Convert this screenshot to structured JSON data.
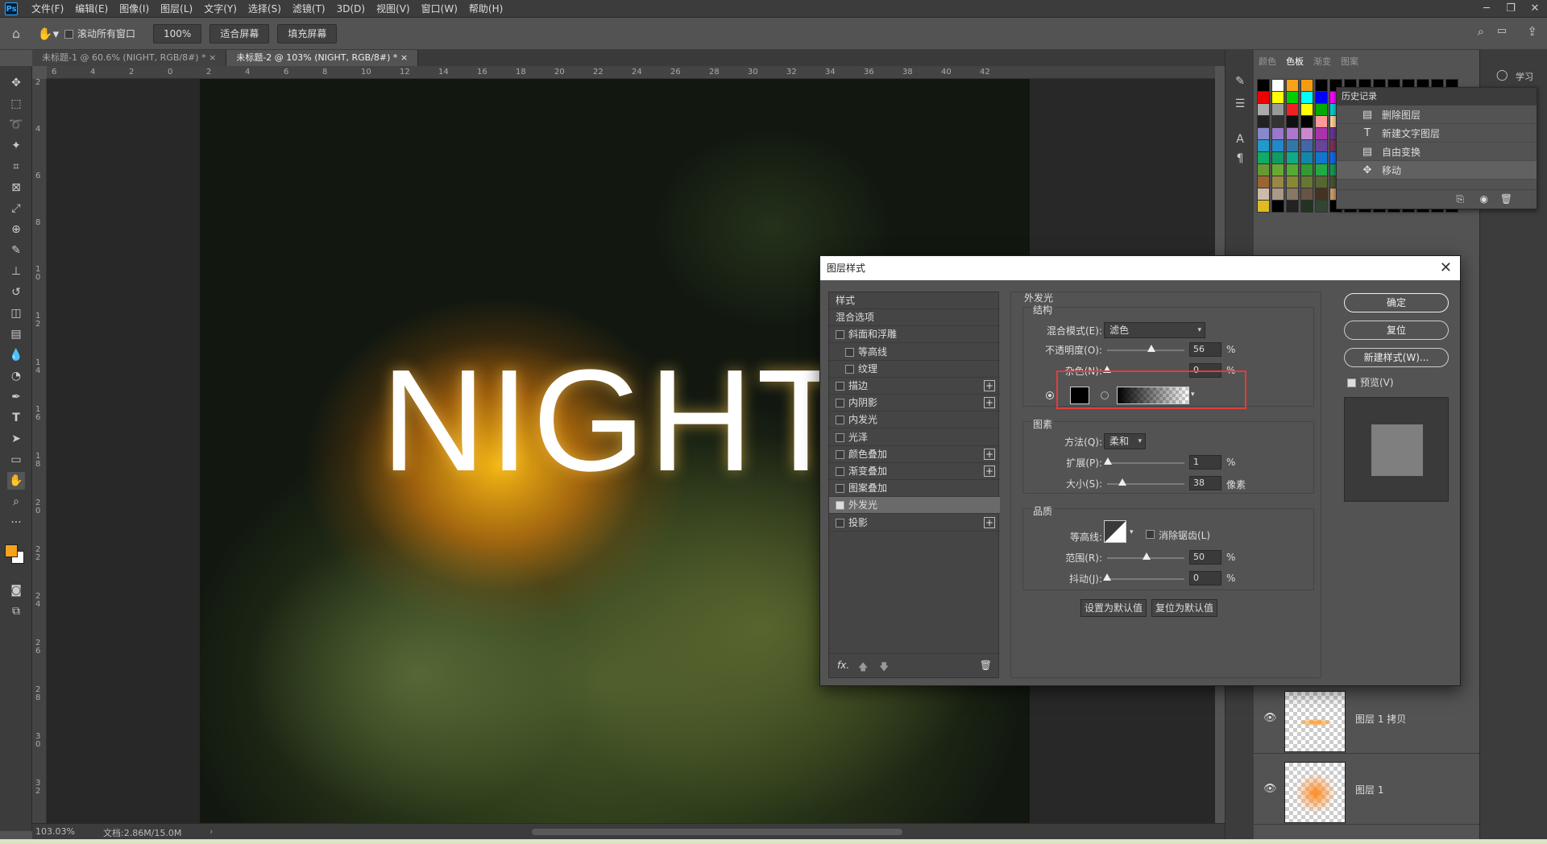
{
  "app": {
    "logo": "Ps",
    "menu": [
      "文件(F)",
      "编辑(E)",
      "图像(I)",
      "图层(L)",
      "文字(Y)",
      "选择(S)",
      "滤镜(T)",
      "3D(D)",
      "视图(V)",
      "窗口(W)",
      "帮助(H)"
    ]
  },
  "options_bar": {
    "scroll_all": "滚动所有窗口",
    "zoom": "100%",
    "fit_screen": "适合屏幕",
    "fill_screen": "填充屏幕"
  },
  "tabs": [
    {
      "label": "未标题-1 @ 60.6% (NIGHT, RGB/8#) *"
    },
    {
      "label": "未标题-2 @ 103% (NIGHT, RGB/8#) *"
    }
  ],
  "ruler_top": [
    "6",
    "4",
    "2",
    "0",
    "2",
    "4",
    "6",
    "8",
    "10",
    "12",
    "14",
    "16",
    "18",
    "20",
    "22",
    "24",
    "26",
    "28",
    "30",
    "32",
    "34",
    "36",
    "38",
    "40",
    "42"
  ],
  "ruler_left": [
    "2",
    "4",
    "6",
    "8",
    "1\n0",
    "1\n2",
    "1\n4",
    "1\n6",
    "1\n8",
    "2\n0",
    "2\n2",
    "2\n4",
    "2\n6",
    "2\n8",
    "3\n0",
    "3\n2"
  ],
  "canvas": {
    "text": "NIGHT"
  },
  "status": {
    "zoom": "103.03%",
    "doc": "文档:2.86M/15.0M"
  },
  "panels": {
    "swatch_tabs": [
      "颜色",
      "色板",
      "渐变",
      "图案"
    ],
    "learn": "学习",
    "history_title": "历史记录",
    "history": [
      {
        "icon": "layer-icon",
        "label": "删除图层"
      },
      {
        "icon": "text-icon",
        "label": "新建文字图层"
      },
      {
        "icon": "layer-icon",
        "label": "自由变换"
      },
      {
        "icon": "move-icon",
        "label": "移动"
      }
    ],
    "layers": [
      {
        "name": "图层 1 拷贝"
      },
      {
        "name": "图层 1"
      }
    ],
    "fore_color": "#f7a21b",
    "back_color": "#ffffff"
  },
  "dialog": {
    "title": "图层样式",
    "styles": [
      {
        "label": "样式",
        "check": false,
        "plus": false,
        "indent": 0,
        "header": true
      },
      {
        "label": "混合选项",
        "check": false,
        "plus": false,
        "indent": 0,
        "header": true
      },
      {
        "label": "斜面和浮雕",
        "check": true,
        "plus": false,
        "indent": 0
      },
      {
        "label": "等高线",
        "check": true,
        "plus": false,
        "indent": 1
      },
      {
        "label": "纹理",
        "check": true,
        "plus": false,
        "indent": 1
      },
      {
        "label": "描边",
        "check": true,
        "plus": true,
        "indent": 0
      },
      {
        "label": "内阴影",
        "check": true,
        "plus": true,
        "indent": 0
      },
      {
        "label": "内发光",
        "check": true,
        "plus": false,
        "indent": 0
      },
      {
        "label": "光泽",
        "check": true,
        "plus": false,
        "indent": 0
      },
      {
        "label": "颜色叠加",
        "check": true,
        "plus": true,
        "indent": 0
      },
      {
        "label": "渐变叠加",
        "check": true,
        "plus": true,
        "indent": 0
      },
      {
        "label": "图案叠加",
        "check": true,
        "plus": false,
        "indent": 0
      },
      {
        "label": "外发光",
        "check": true,
        "plus": false,
        "indent": 0,
        "checked": true,
        "selected": true
      },
      {
        "label": "投影",
        "check": true,
        "plus": true,
        "indent": 0
      }
    ],
    "section_title": "外发光",
    "structure": {
      "title": "结构",
      "blend_mode_label": "混合模式(E):",
      "blend_mode": "滤色",
      "opacity_label": "不透明度(O):",
      "opacity": "56",
      "noise_label": "杂色(N):",
      "noise": "0",
      "percent": "%"
    },
    "elements": {
      "title": "图素",
      "method_label": "方法(Q):",
      "method": "柔和",
      "spread_label": "扩展(P):",
      "spread": "1",
      "size_label": "大小(S):",
      "size": "38",
      "size_unit": "像素",
      "percent": "%"
    },
    "quality": {
      "title": "品质",
      "contour_label": "等高线:",
      "antialias_label": "消除锯齿(L)",
      "range_label": "范围(R):",
      "range": "50",
      "jitter_label": "抖动(J):",
      "jitter": "0",
      "percent": "%"
    },
    "set_default": "设置为默认值",
    "reset_default": "复位为默认值",
    "ok": "确定",
    "reset": "复位",
    "new_style": "新建样式(W)...",
    "preview": "预览(V)",
    "footer_fx": "fx.",
    "glow_color": "#000000"
  }
}
